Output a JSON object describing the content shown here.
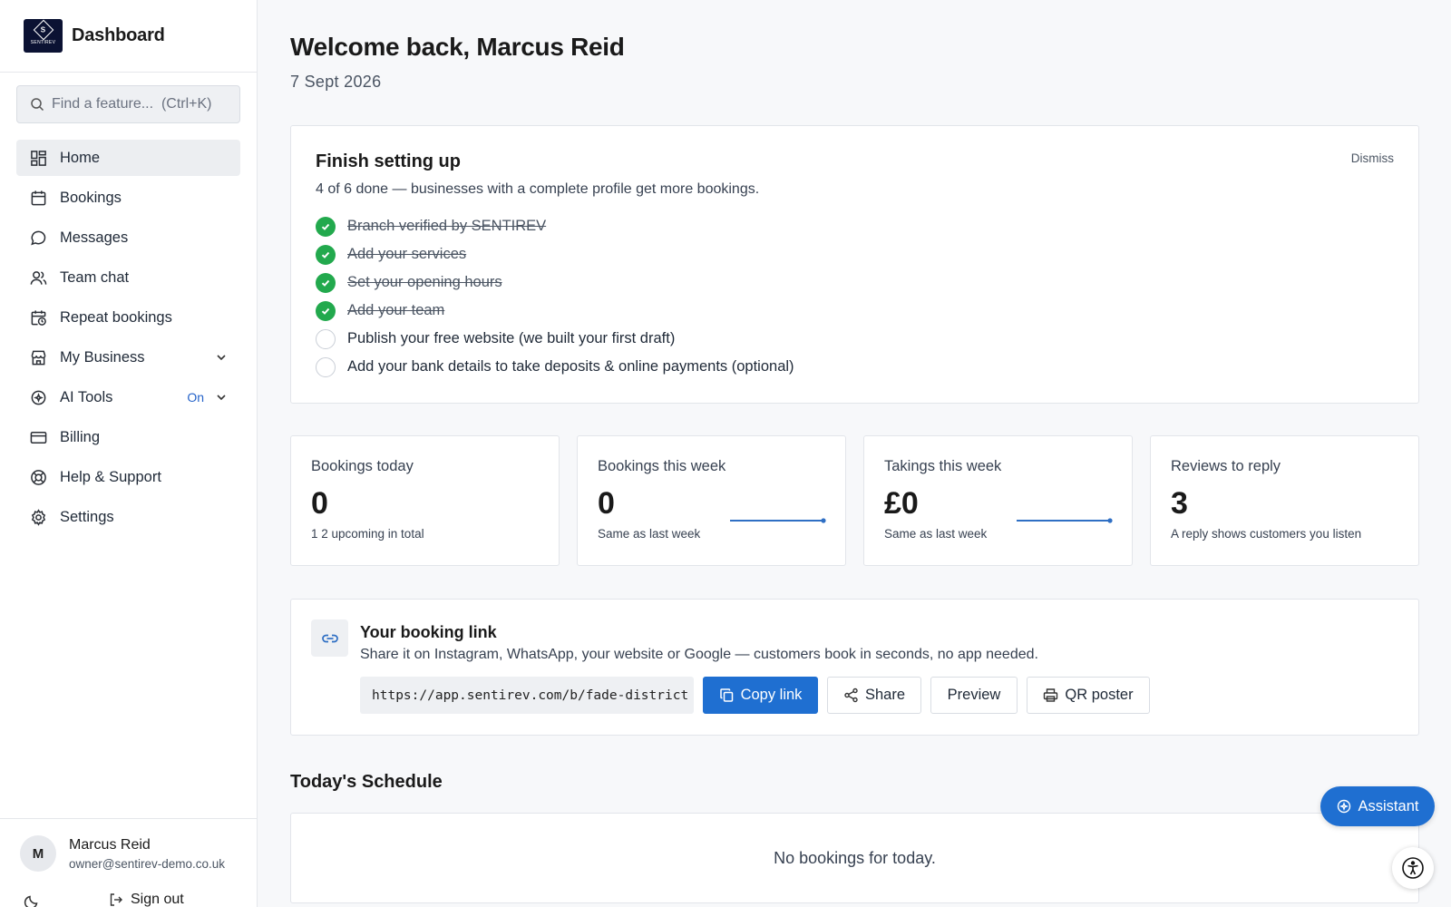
{
  "brand": {
    "logo_text": "SENTIREV",
    "logo_letter": "S",
    "title": "Dashboard"
  },
  "search": {
    "placeholder": "Find a feature...  (Ctrl+K)"
  },
  "nav": [
    {
      "label": "Home",
      "icon": "grid-icon",
      "active": true
    },
    {
      "label": "Bookings",
      "icon": "calendar-icon"
    },
    {
      "label": "Messages",
      "icon": "chat-bubble-icon"
    },
    {
      "label": "Team chat",
      "icon": "users-icon"
    },
    {
      "label": "Repeat bookings",
      "icon": "calendar-clock-icon"
    },
    {
      "label": "My Business",
      "icon": "store-icon",
      "expandable": true
    },
    {
      "label": "AI Tools",
      "icon": "sparkle-circle-icon",
      "expandable": true,
      "status": "On"
    },
    {
      "label": "Billing",
      "icon": "credit-card-icon"
    },
    {
      "label": "Help & Support",
      "icon": "lifebuoy-icon"
    },
    {
      "label": "Settings",
      "icon": "gear-icon"
    }
  ],
  "user": {
    "initial": "M",
    "name": "Marcus Reid",
    "email": "owner@sentirev-demo.co.uk",
    "sign_out": "Sign out"
  },
  "header": {
    "welcome": "Welcome back, Marcus Reid",
    "date": "7 Sept 2026"
  },
  "setup": {
    "title": "Finish setting up",
    "subtitle": "4 of 6 done — businesses with a complete profile get more bookings.",
    "dismiss": "Dismiss",
    "tasks": [
      {
        "label": "Branch verified by SENTIREV",
        "done": true
      },
      {
        "label": "Add your services",
        "done": true
      },
      {
        "label": "Set your opening hours",
        "done": true
      },
      {
        "label": "Add your team",
        "done": true
      },
      {
        "label": "Publish your free website (we built your first draft)",
        "done": false
      },
      {
        "label": "Add your bank details to take deposits & online payments (optional)",
        "done": false
      }
    ]
  },
  "stats": [
    {
      "label": "Bookings today",
      "value": "0",
      "note": "1 2 upcoming in total",
      "sparkline": false
    },
    {
      "label": "Bookings this week",
      "value": "0",
      "note": "Same as last week",
      "sparkline": true
    },
    {
      "label": "Takings this week",
      "value": "£0",
      "note": "Same as last week",
      "sparkline": true
    },
    {
      "label": "Reviews to reply",
      "value": "3",
      "note": "A reply shows customers you listen",
      "sparkline": false
    }
  ],
  "booking_link": {
    "title": "Your booking link",
    "subtitle": "Share it on Instagram, WhatsApp, your website or Google — customers book in seconds, no app needed.",
    "url": "https://app.sentirev.com/b/fade-district",
    "copy_label": "Copy link",
    "share_label": "Share",
    "preview_label": "Preview",
    "qr_label": "QR poster"
  },
  "schedule": {
    "title": "Today's Schedule",
    "empty": "No bookings for today."
  },
  "assistant": {
    "label": "Assistant"
  },
  "colors": {
    "accent": "#1f6fd1",
    "success": "#22a94d",
    "status_on": "#2563c9"
  }
}
